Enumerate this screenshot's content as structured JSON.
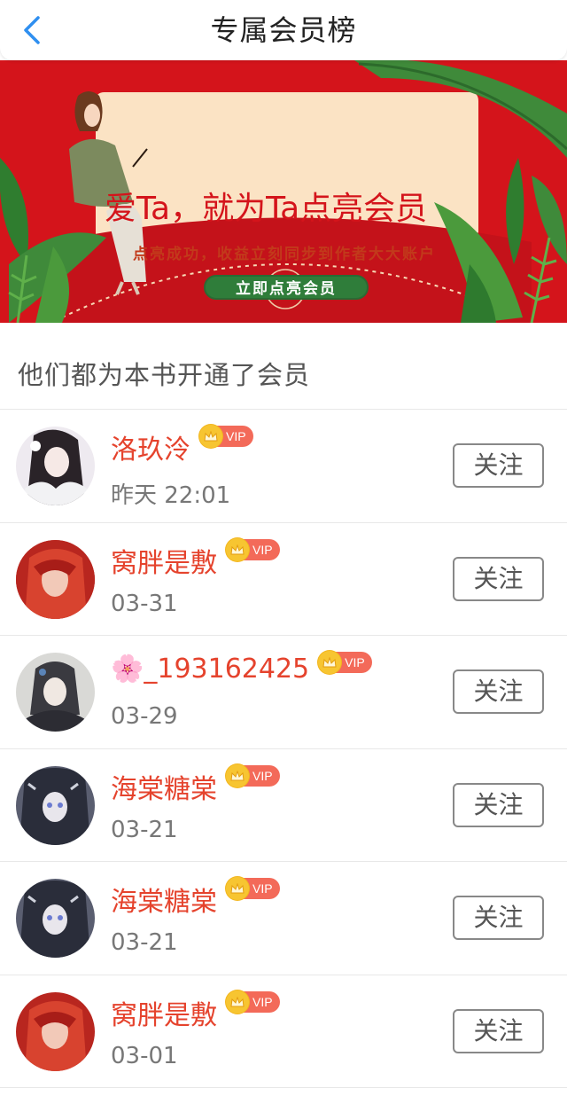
{
  "header": {
    "title": "专属会员榜",
    "back_icon": "chevron-left-icon"
  },
  "banner": {
    "title": "爱Ta，就为Ta点亮会员",
    "subtitle": "点亮成功，收益立刻同步到作者大大账户",
    "button_label": "立即点亮会员",
    "colors": {
      "background": "#d4141b",
      "panel": "#fbe3c4",
      "button": "#2f7d3a",
      "leaf": "#3f8a3a"
    }
  },
  "section": {
    "title": "他们都为本书开通了会员"
  },
  "members": [
    {
      "name": "洛玖泠",
      "time": "昨天 22:01",
      "badge": "VIP",
      "follow_label": "关注",
      "avatar": "avatar-girl-white-hair"
    },
    {
      "name": "窝胖是敷",
      "time": "03-31",
      "badge": "VIP",
      "follow_label": "关注",
      "avatar": "avatar-girl-red-hair"
    },
    {
      "name": "🌸_193162425",
      "time": "03-29",
      "badge": "VIP",
      "follow_label": "关注",
      "avatar": "avatar-girl-grey"
    },
    {
      "name": "海棠糖棠",
      "time": "03-21",
      "badge": "VIP",
      "follow_label": "关注",
      "avatar": "avatar-girl-dark"
    },
    {
      "name": "海棠糖棠",
      "time": "03-21",
      "badge": "VIP",
      "follow_label": "关注",
      "avatar": "avatar-girl-dark"
    },
    {
      "name": "窝胖是敷",
      "time": "03-01",
      "badge": "VIP",
      "follow_label": "关注",
      "avatar": "avatar-girl-red-hair"
    }
  ],
  "colors": {
    "name": "#e5432d",
    "vip_badge": "#f36a59",
    "crown": "#f7c531"
  }
}
